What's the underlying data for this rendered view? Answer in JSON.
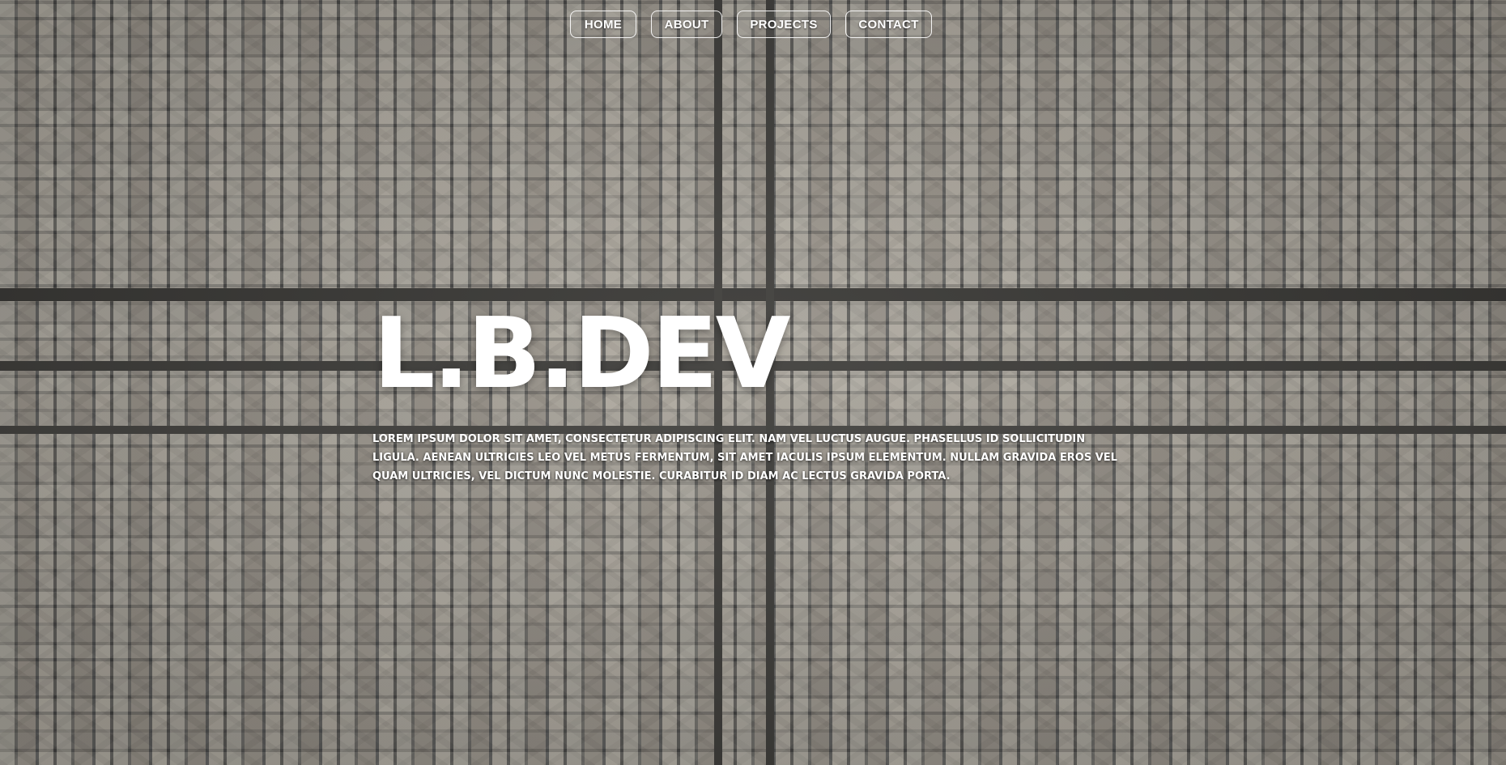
{
  "nav": {
    "items": [
      {
        "label": "HOME"
      },
      {
        "label": "ABOUT"
      },
      {
        "label": "PROJECTS"
      },
      {
        "label": "CONTACT"
      }
    ]
  },
  "hero": {
    "title": "L.B.DEV",
    "intro": "LOREM IPSUM DOLOR SIT AMET, CONSECTETUR ADIPISCING ELIT. NAM VEL LUCTUS AUGUE. PHASELLUS ID SOLLICITUDIN LIGULA. AENEAN ULTRICIES LEO VEL METUS FERMENTUM, SIT AMET IACULIS IPSUM ELEMENTUM. NULLAM GRAVIDA EROS VEL QUAM ULTRICIES, VEL DICTUM NUNC MOLESTIE. CURABITUR ID DIAM AC LECTUS GRAVIDA PORTA."
  },
  "colors": {
    "text": "#ffffff",
    "nav_border": "#ffffff"
  }
}
